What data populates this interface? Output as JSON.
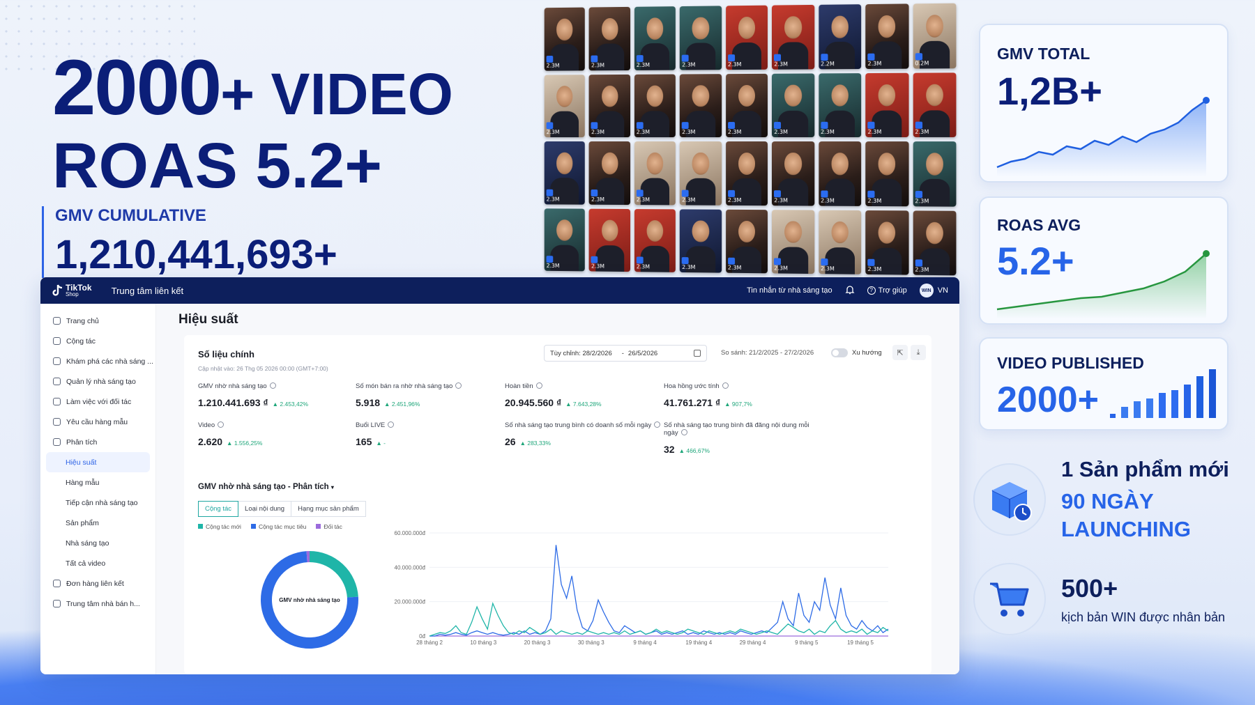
{
  "hero": {
    "big_number": "2000",
    "big_suffix": "+ VIDEO",
    "roas_line": "ROAS 5.2+",
    "gmv_label": "GMV CUMULATIVE",
    "gmv_value": "1,210,441,693+"
  },
  "video_grid": {
    "views": [
      "2.3M",
      "2.3M",
      "2.3M",
      "2.3M",
      "2.3M",
      "2.3M",
      "2.2M",
      "2.3M",
      "0.2M",
      "2.3M",
      "2.3M",
      "2.3M",
      "2.3M",
      "2.3M",
      "2.3M",
      "2.3M",
      "2.3M",
      "2.3M",
      "2.3M",
      "2.3M",
      "2.3M",
      "2.3M",
      "2.3M",
      "2.3M",
      "2.3M",
      "2.3M",
      "2.3M",
      "2.3M",
      "2.3M",
      "2.3M",
      "2.3M",
      "2.3M",
      "2.3M",
      "2.3M",
      "2.3M",
      "2.3M"
    ]
  },
  "cards": {
    "gmv_total": {
      "title": "GMV TOTAL",
      "value": "1,2B+"
    },
    "roas_avg": {
      "title": "ROAS AVG",
      "value": "5.2+"
    },
    "video_published": {
      "title": "VIDEO PUBLISHED",
      "value": "2000+"
    }
  },
  "features": {
    "launch": {
      "line1": "1 Sản phẩm mới",
      "line2": "90 NGÀY",
      "line3": "LAUNCHING"
    },
    "scripts": {
      "line1": "500+",
      "line2": "kịch bản WIN được nhân bản"
    }
  },
  "dashboard": {
    "logo": "TikTok",
    "logo_sub": "Shop",
    "app_title": "Trung tâm liên kết",
    "topbar": {
      "messages": "Tin nhắn từ nhà sáng tạo",
      "help": "Trợ giúp",
      "avatar": "WIN",
      "region": "VN"
    },
    "sidebar": [
      {
        "label": "Trang chủ",
        "sub": false
      },
      {
        "label": "Cộng tác",
        "sub": false
      },
      {
        "label": "Khám phá các nhà sáng ...",
        "sub": false
      },
      {
        "label": "Quản lý nhà sáng tạo",
        "sub": false
      },
      {
        "label": "Làm việc với đối tác",
        "sub": false
      },
      {
        "label": "Yêu cầu hàng mẫu",
        "sub": false
      },
      {
        "label": "Phân tích",
        "sub": false
      },
      {
        "label": "Hiệu suất",
        "sub": true,
        "active": true
      },
      {
        "label": "Hàng mẫu",
        "sub": true
      },
      {
        "label": "Tiếp cận nhà sáng tạo",
        "sub": true
      },
      {
        "label": "Sản phẩm",
        "sub": true
      },
      {
        "label": "Nhà sáng tạo",
        "sub": true
      },
      {
        "label": "Tất cả video",
        "sub": true
      },
      {
        "label": "Đơn hàng liên kết",
        "sub": false
      },
      {
        "label": "Trung tâm nhà bán h...",
        "sub": false
      }
    ],
    "page_title": "Hiệu suất",
    "panel": {
      "title": "Số liệu chính",
      "updated": "Cập nhật vào: 26 Thg 05 2026 00:00 (GMT+7:00)",
      "date_label": "Tùy chỉnh: 28/2/2026",
      "date_sep": "-",
      "date_end": "26/5/2026",
      "compare": "So sánh: 21/2/2025 - 27/2/2026",
      "trend": "Xu hướng"
    },
    "metrics": [
      {
        "label": "GMV nhờ nhà sáng tạo",
        "value": "1.210.441.693 ₫",
        "change": "▲ 2.453,42%"
      },
      {
        "label": "Số món bán ra nhờ nhà sáng tạo",
        "value": "5.918",
        "change": "▲ 2.451,96%"
      },
      {
        "label": "Hoàn tiền",
        "value": "20.945.560 ₫",
        "change": "▲ 7.643,28%"
      },
      {
        "label": "Hoa hồng ước tính",
        "value": "41.761.271 ₫",
        "change": "▲ 907,7%"
      },
      {
        "label": "Video",
        "value": "2.620",
        "change": "▲ 1.556,25%"
      },
      {
        "label": "Buổi LIVE",
        "value": "165",
        "change": "▲ -"
      },
      {
        "label": "Số nhà sáng tạo trung bình có doanh số mỗi ngày",
        "value": "26",
        "change": "▲ 283,33%"
      },
      {
        "label": "Số nhà sáng tạo trung bình đã đăng nội dung mỗi ngày",
        "value": "32",
        "change": "▲ 466,67%"
      }
    ],
    "section_title": "GMV nhờ nhà sáng tạo - Phân tích",
    "tabs": [
      "Cộng tác",
      "Loại nội dung",
      "Hạng mục sản phẩm"
    ],
    "legend": [
      {
        "label": "Cộng tác mới",
        "color": "#1fb5a8"
      },
      {
        "label": "Cộng tác mục tiêu",
        "color": "#2d6be6"
      },
      {
        "label": "Đối tác",
        "color": "#9b6bdc"
      }
    ],
    "donut_label": "GMV nhờ nhà sáng tạo"
  },
  "chart_data": {
    "type": "line",
    "y_ticks": [
      "60.000.000đ",
      "40.000.000đ",
      "20.000.000đ",
      "0đ"
    ],
    "ylim": [
      0,
      60000000
    ],
    "x_ticks": [
      "28 tháng 2",
      "10 tháng 3",
      "20 tháng 3",
      "30 tháng 3",
      "9 tháng 4",
      "19 tháng 4",
      "29 tháng 4",
      "9 tháng 5",
      "19 tháng 5"
    ],
    "series": [
      {
        "name": "Cộng tác mới",
        "color": "#1fb5a8",
        "values": [
          0,
          1000000,
          2000000,
          1500000,
          3000000,
          6000000,
          2000000,
          1000000,
          8000000,
          17000000,
          10000000,
          4000000,
          19000000,
          12000000,
          6000000,
          2000000,
          1000000,
          3000000,
          2000000,
          5000000,
          3000000,
          1000000,
          2000000,
          4000000,
          1000000,
          3000000,
          2000000,
          1000000,
          2000000,
          1000000,
          3000000,
          2000000,
          1000000,
          2000000,
          1000000,
          2000000,
          1000000,
          3000000,
          1000000,
          2000000,
          3000000,
          1000000,
          2000000,
          4000000,
          2000000,
          3000000,
          2000000,
          1000000,
          2000000,
          4000000,
          3000000,
          2000000,
          1000000,
          3000000,
          2000000,
          1000000,
          2000000,
          3000000,
          2000000,
          4000000,
          3000000,
          2000000,
          1000000,
          2000000,
          3000000,
          2000000,
          1000000,
          4000000,
          7000000,
          5000000,
          3000000,
          2000000,
          4000000,
          1000000,
          3000000,
          2000000,
          6000000,
          9000000,
          4000000,
          2000000,
          3000000,
          2000000,
          4000000,
          1000000,
          3000000,
          2000000,
          5000000,
          3000000
        ]
      },
      {
        "name": "Cộng tác mục tiêu",
        "color": "#2d6be6",
        "values": [
          0,
          0,
          1000000,
          500000,
          1000000,
          2000000,
          1000000,
          500000,
          2000000,
          3000000,
          2000000,
          1000000,
          2000000,
          1000000,
          500000,
          1000000,
          2000000,
          1000000,
          3000000,
          1000000,
          2000000,
          1000000,
          3000000,
          10000000,
          53000000,
          30000000,
          22000000,
          35000000,
          15000000,
          5000000,
          3000000,
          9000000,
          21000000,
          14000000,
          8000000,
          3000000,
          2000000,
          6000000,
          4000000,
          2000000,
          3000000,
          1000000,
          2000000,
          3000000,
          1000000,
          2000000,
          1000000,
          2000000,
          3000000,
          1000000,
          2000000,
          1000000,
          3000000,
          2000000,
          1000000,
          2000000,
          1000000,
          2000000,
          1000000,
          3000000,
          2000000,
          1000000,
          2000000,
          3000000,
          2000000,
          5000000,
          8000000,
          20000000,
          10000000,
          6000000,
          25000000,
          12000000,
          8000000,
          20000000,
          15000000,
          34000000,
          18000000,
          10000000,
          28000000,
          12000000,
          6000000,
          4000000,
          9000000,
          5000000,
          3000000,
          6000000,
          2000000,
          4000000
        ]
      },
      {
        "name": "Đối tác",
        "color": "#9b6bdc",
        "values": [
          0,
          0,
          0,
          0,
          0,
          0,
          0,
          0,
          0,
          0,
          0,
          0,
          0,
          0,
          0,
          0,
          0,
          0,
          0,
          0,
          0,
          0,
          0,
          0,
          0,
          0,
          0,
          0,
          0,
          0,
          0,
          0,
          0,
          0,
          0,
          0,
          0,
          0,
          0,
          0,
          0,
          0,
          0,
          0,
          0,
          0,
          0,
          0,
          0,
          0,
          0,
          0,
          0,
          0,
          0,
          0,
          0,
          0,
          0,
          0,
          0,
          0,
          0,
          0,
          0,
          0,
          0,
          0,
          0,
          0,
          0,
          0,
          0,
          0,
          0,
          0,
          0,
          0,
          0,
          0,
          0,
          0,
          0,
          0,
          0,
          0,
          0,
          0
        ]
      }
    ],
    "donut": {
      "segments": [
        {
          "name": "Cộng tác mới",
          "value": 24
        },
        {
          "name": "Cộng tác mục tiêu",
          "value": 75
        },
        {
          "name": "Đối tác",
          "value": 1
        }
      ]
    }
  }
}
